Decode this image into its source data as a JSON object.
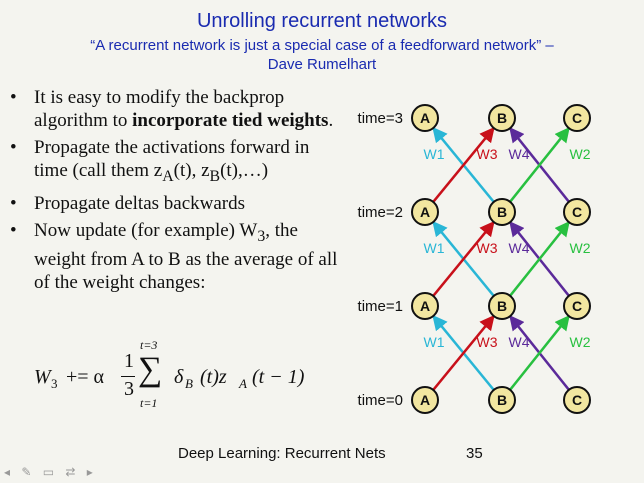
{
  "slide": {
    "title": "Unrolling recurrent networks",
    "quote_line1": "“A recurrent network is just a special case of a feedforward network” –",
    "quote_line2": "Dave Rumelhart",
    "bullets": [
      {
        "pre": "It is easy to modify the backprop algorithm to ",
        "bold": "incorporate tied weights",
        "post": "."
      },
      {
        "pre": "Propagate the activations forward in time (call them z",
        "sub1": "A",
        "mid": "(t), z",
        "sub2": "B",
        "end": "(t),…)"
      },
      {
        "text": "Propagate deltas backwards"
      },
      {
        "text": "Now update (for example) W",
        "sub": "3",
        "text2": ", the weight from A to B as the average of all of the weight changes:"
      }
    ],
    "formula": {
      "lhs": "W",
      "lhs_sub": "3",
      "op": "+= α",
      "frac_num": "1",
      "frac_den": "3",
      "sum_top": "t=3",
      "sum_bottom": "t=1",
      "delta": "δ",
      "delta_sub": "B",
      "delta_arg": "(t)z",
      "z_sub": "A",
      "z_arg": "(t − 1)"
    },
    "footer": "Deep Learning: Recurrent Nets",
    "page_number": "35"
  },
  "diagram": {
    "time_labels": [
      "time=3",
      "time=2",
      "time=1",
      "time=0"
    ],
    "node_labels": [
      "A",
      "B",
      "C"
    ],
    "weight_labels": [
      "W1",
      "W3",
      "W4",
      "W2"
    ],
    "colors": {
      "W1": "#29b6d6",
      "W3": "#c8101a",
      "W4": "#5b2a9a",
      "W2": "#28c040",
      "node_fill": "#f2e6a0"
    }
  }
}
